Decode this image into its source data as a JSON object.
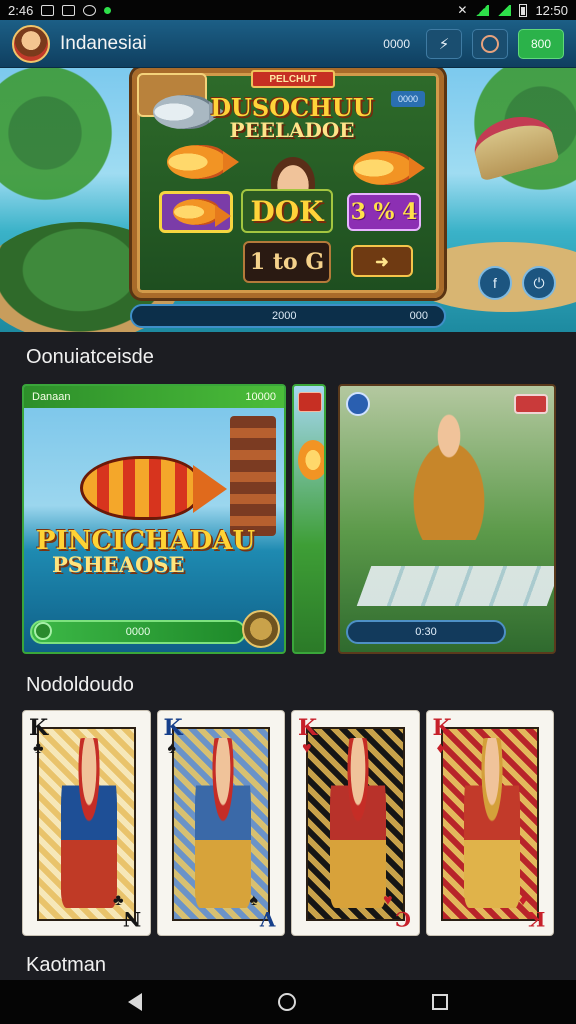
{
  "status_bar": {
    "time_left": "2:46",
    "time_right": "12:50",
    "icons": [
      "image-icon",
      "screenshot-icon",
      "chat-icon",
      "notification-dot-icon",
      "mute-icon",
      "wifi-icon",
      "signal-icon",
      "battery-icon"
    ]
  },
  "header": {
    "title": "Indanesiai",
    "coins": "0000",
    "icons": [
      "avatar",
      "lightning-icon",
      "profile-icon"
    ],
    "cta_label": "800",
    "accent": "#1c5f86",
    "cta_color": "#2bb24a"
  },
  "hero": {
    "badge": "PELCHUT",
    "tag": "0000",
    "title_line1": "DUSOCHUU",
    "title_line2": "PEELADOE",
    "ok_label": "DOK",
    "odds_label": "3 % 4",
    "main_label": "1 to G",
    "progress_left": "2000",
    "progress_right": "000",
    "share_icon": "share-icon",
    "power_icon": "power-icon"
  },
  "sections": {
    "featured_title": "Oonuiatceisde",
    "cards_title": "Nodoldoudo",
    "bottom_title": "Kaotman"
  },
  "promos": [
    {
      "header_left": "Danaan",
      "header_right": "10000",
      "title_line1": "PINCICHADAU",
      "title_line2": "PSHEAOSE",
      "progress": "0000"
    },
    {
      "progress": "0:30"
    }
  ],
  "cards": [
    {
      "rank": "K",
      "suit": "♣",
      "corner": "N",
      "color": "black"
    },
    {
      "rank": "K",
      "suit": "♠",
      "corner": "V",
      "color": "blue"
    },
    {
      "rank": "K",
      "suit": "♥",
      "corner": "C",
      "color": "red"
    },
    {
      "rank": "K",
      "suit": "♦",
      "corner": "K",
      "color": "red"
    }
  ],
  "nav": {
    "icons": [
      "back-icon",
      "home-icon",
      "recent-apps-icon"
    ]
  }
}
